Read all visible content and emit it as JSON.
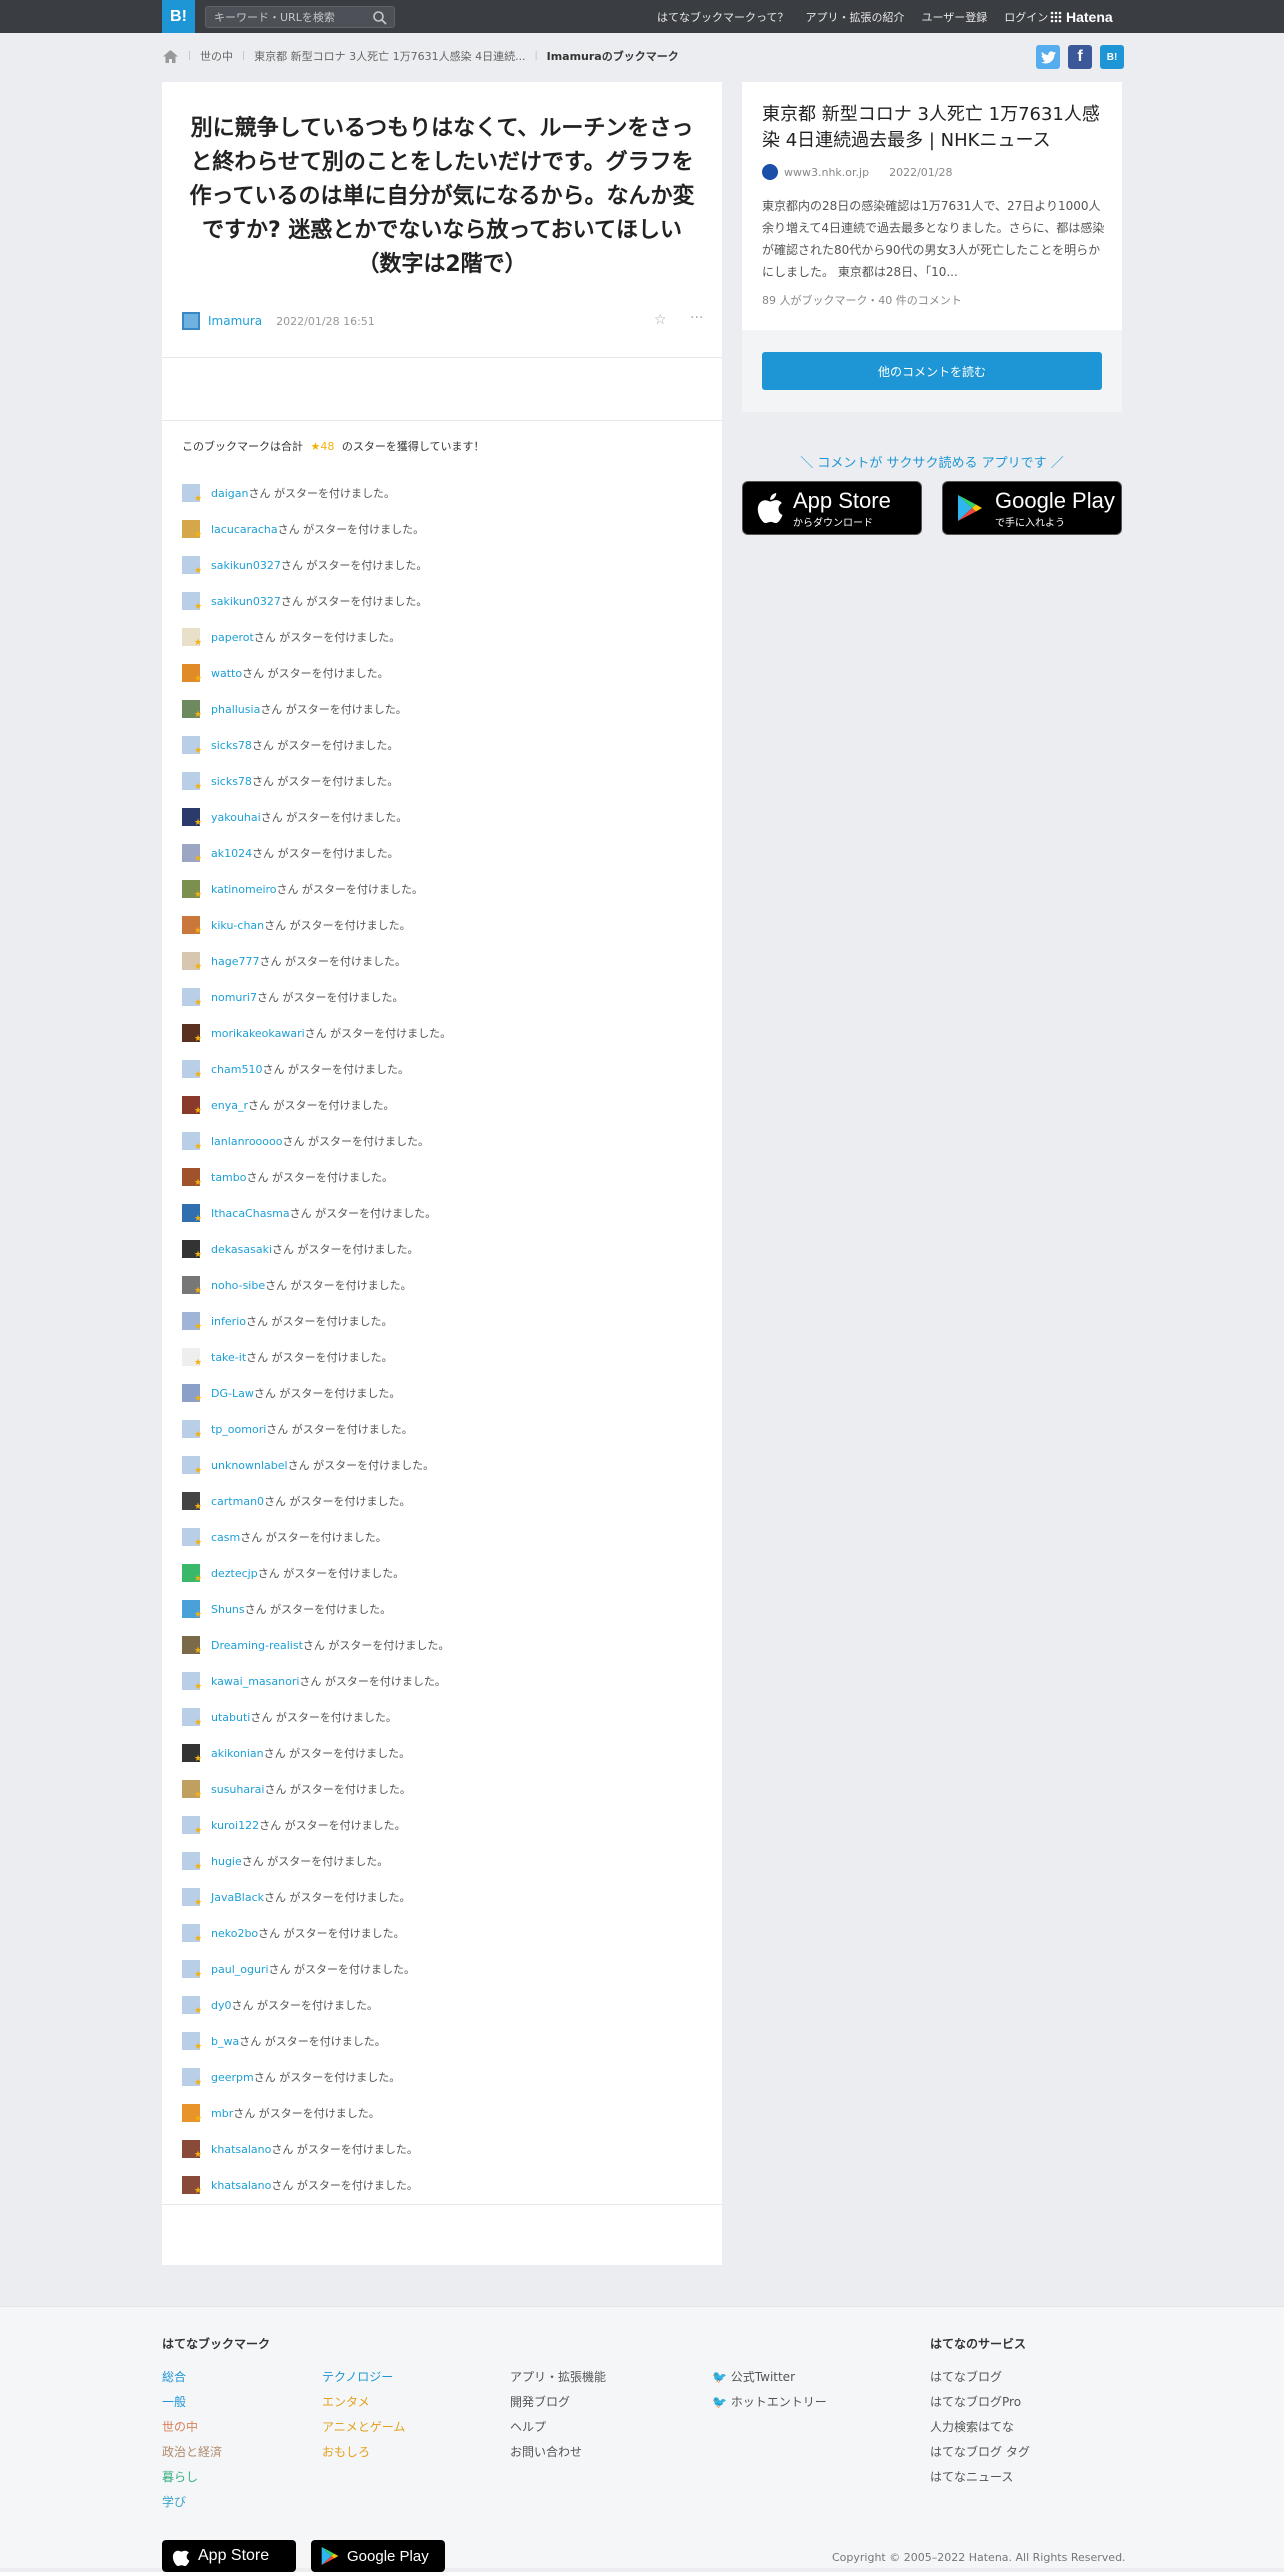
{
  "topbar": {
    "logo": "B!",
    "search_placeholder": "キーワード・URLを検索",
    "nav": [
      "はてなブックマークって？",
      "アプリ・拡張の紹介",
      "ユーザー登録",
      "ログイン"
    ],
    "brand": "Hatena"
  },
  "breadcrumb": {
    "items": [
      "世の中",
      "東京都 新型コロナ 3人死亡 1万7631人感染 4日連続...",
      "Imamuraのブックマーク"
    ]
  },
  "share": {
    "twitter": "t",
    "facebook": "f",
    "hatena": "B!"
  },
  "comment": {
    "text": "別に競争しているつもりはなくて、ルーチンをさっと終わらせて別のことをしたいだけです。グラフを作っているのは単に自分が気になるから。なんか変ですか? 迷惑とかでないなら放っておいてほしい（数字は2階で）",
    "author": "Imamura",
    "time": "2022/01/28 16:51",
    "more": "···"
  },
  "stars": {
    "summary_prefix": "このブックマークは合計",
    "count": "★48",
    "summary_suffix": "のスターを獲得しています！",
    "suffix": "さん がスターを付けました。",
    "users": [
      "daigan",
      "lacucaracha",
      "sakikun0327",
      "sakikun0327",
      "paperot",
      "watto",
      "phallusia",
      "sicks78",
      "sicks78",
      "yakouhai",
      "ak1024",
      "katinomeiro",
      "kiku-chan",
      "hage777",
      "nomuri7",
      "morikakeokawari",
      "cham510",
      "enya_r",
      "lanlanrooooo",
      "tambo",
      "IthacaChasma",
      "dekasasaki",
      "noho-sibe",
      "inferio",
      "take-it",
      "DG-Law",
      "tp_oomori",
      "unknownlabel",
      "cartman0",
      "casm",
      "deztecjp",
      "Shuns",
      "Dreaming-realist",
      "kawai_masanori",
      "utabuti",
      "akikonian",
      "susuharai",
      "kuroi122",
      "hugie",
      "JavaBlack",
      "neko2bo",
      "paul_oguri",
      "dy0",
      "b_wa",
      "geerpm",
      "mbr",
      "khatsalano",
      "khatsalano"
    ]
  },
  "article": {
    "title": "東京都 新型コロナ 3人死亡 1万7631人感染 4日連続過去最多 | NHKニュース",
    "domain": "www3.nhk.or.jp",
    "date": "2022/01/28",
    "summary": "東京都内の28日の感染確認は1万7631人で、27日より1000人余り増えて4日連続で過去最多となりました。さらに、都は感染が確認された80代から90代の男女3人が死亡したことを明らかにしました。 東京都は28日、「10...",
    "count": "89 人がブックマーク・40 件のコメント",
    "read_button": "他のコメントを読む"
  },
  "app": {
    "note": "＼ コメントが サクサク読める アプリです ／",
    "appstore_big": "App Store",
    "appstore_small": "からダウンロード",
    "googleplay_big": "Google Play",
    "googleplay_small": "で手に入れよう"
  },
  "footer": {
    "title": "はてなブックマーク",
    "col1": [
      "総合",
      "一般",
      "世の中",
      "政治と経済",
      "暮らし",
      "学び"
    ],
    "col2": [
      "テクノロジー",
      "エンタメ",
      "アニメとゲーム",
      "おもしろ"
    ],
    "col3": [
      "アプリ・拡張機能",
      "開発ブログ",
      "ヘルプ",
      "お問い合わせ"
    ],
    "col4": [
      "公式Twitter",
      "ホットエントリー"
    ],
    "services_title": "はてなのサービス",
    "services": [
      "はてなブログ",
      "はてなブログPro",
      "人力検索はてな",
      "はてなブログ タグ",
      "はてなニュース"
    ],
    "copyright": "Copyright © 2005–2022 Hatena. All Rights Reserved.",
    "appstore_label": "App Store",
    "googleplay_label": "Google Play"
  },
  "colors": {
    "accent": "#1e96d5",
    "star": "#f4b10c",
    "topbar": "#3a3d42"
  }
}
